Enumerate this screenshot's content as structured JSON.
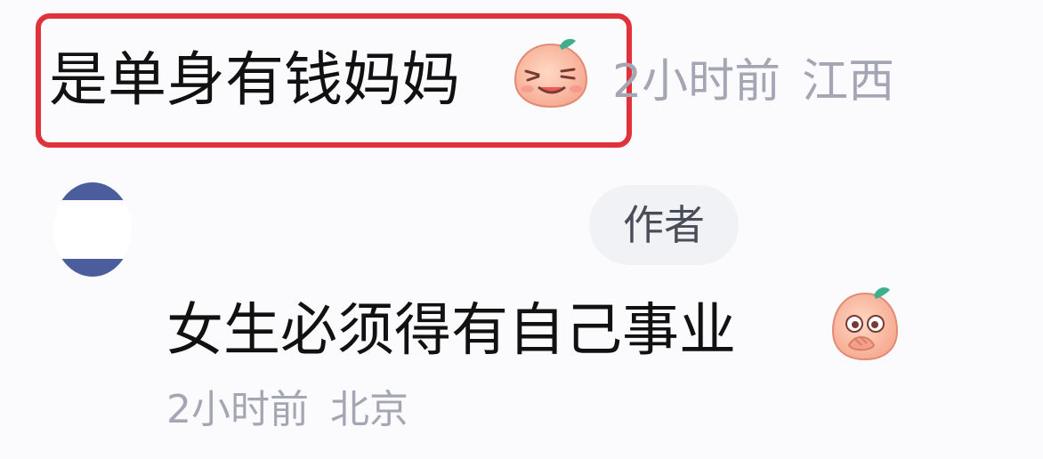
{
  "comment1": {
    "text": "是单身有钱妈妈",
    "emoji": "smiling-peach-emoji",
    "time": "2小时前",
    "location": "江西"
  },
  "comment2": {
    "avatar": "avatar",
    "badge": "作者",
    "text": "女生必须得有自己事业",
    "emoji": "covering-mouth-peach-emoji",
    "time": "2小时前",
    "location": "北京"
  },
  "colors": {
    "highlight": "#e0323a",
    "primary_text": "#111111",
    "meta_text": "#a4a6b4",
    "avatar_band": "#4c5d9d"
  }
}
